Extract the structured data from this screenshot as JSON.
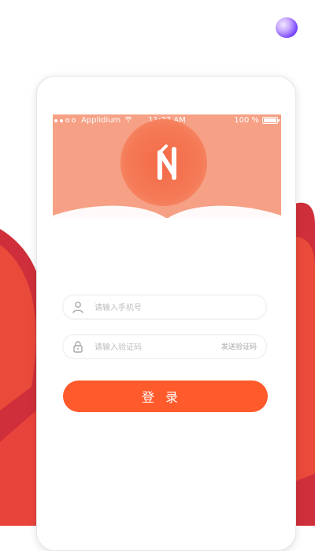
{
  "status_bar": {
    "carrier": "Applidium",
    "time": "11:27 AM",
    "battery": "100 %"
  },
  "form": {
    "phone_placeholder": "请输入手机号",
    "code_placeholder": "请输入验证码",
    "send_code_label": "发送验证码",
    "login_label": "登录"
  },
  "icons": {
    "phone_field_icon": "user-icon",
    "code_field_icon": "lock-icon",
    "wifi_icon": "wifi-icon",
    "battery_icon": "battery-icon",
    "logo_icon": "n-logo-icon"
  },
  "colors": {
    "accent": "#ff5a2b",
    "header": "#f6a085",
    "background_red": "#e94b3a"
  }
}
